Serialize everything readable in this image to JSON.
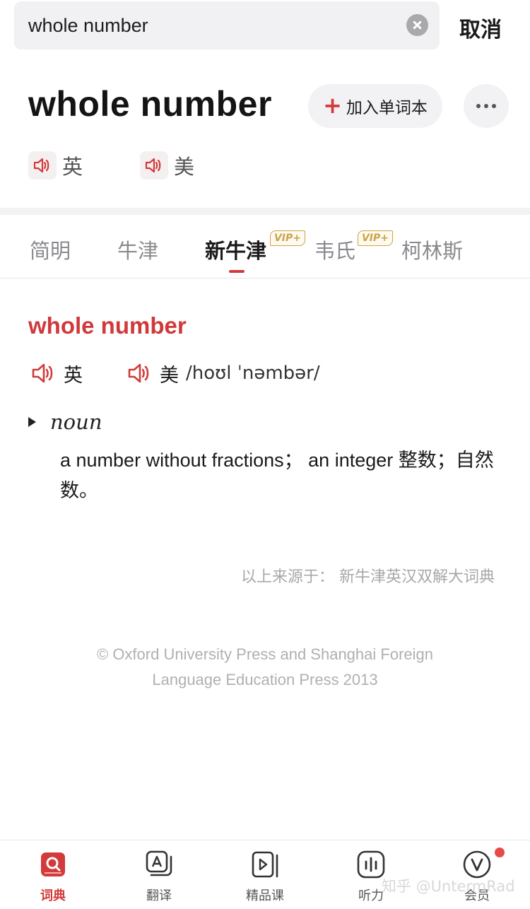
{
  "search": {
    "value": "whole number",
    "cancel_label": "取消"
  },
  "header": {
    "headword": "whole number",
    "add_label": "加入单词本",
    "add_plus": "+",
    "pron_uk_label": "英",
    "pron_us_label": "美"
  },
  "tabs": [
    {
      "label": "简明",
      "active": false,
      "vip": false
    },
    {
      "label": "牛津",
      "active": false,
      "vip": false
    },
    {
      "label": "新牛津",
      "active": true,
      "vip": true
    },
    {
      "label": "韦氏",
      "active": false,
      "vip": true
    },
    {
      "label": "柯林斯",
      "active": false,
      "vip": false
    }
  ],
  "vip_badge": "VIP+",
  "entry": {
    "word": "whole number",
    "uk_label": "英",
    "us_label": "美",
    "us_phonetic": "/hoʊl ˈnəmbər/",
    "pos": "noun",
    "definition": "a number without fractions； an integer 整数；自然数。"
  },
  "source": "以上来源于： 新牛津英汉双解大词典",
  "copyright_line1": "© Oxford University Press and Shanghai Foreign",
  "copyright_line2": "Language Education Press 2013",
  "bottom_nav": [
    {
      "label": "词典",
      "icon": "dictionary-icon",
      "active": true
    },
    {
      "label": "翻译",
      "icon": "translate-icon",
      "active": false
    },
    {
      "label": "精品课",
      "icon": "course-icon",
      "active": false
    },
    {
      "label": "听力",
      "icon": "listening-icon",
      "active": false
    },
    {
      "label": "会员",
      "icon": "vip-member-icon",
      "active": false
    }
  ],
  "watermark": "知乎 @UntermRad",
  "colors": {
    "accent": "#d33a3a",
    "vip_gold": "#c9a34a"
  }
}
